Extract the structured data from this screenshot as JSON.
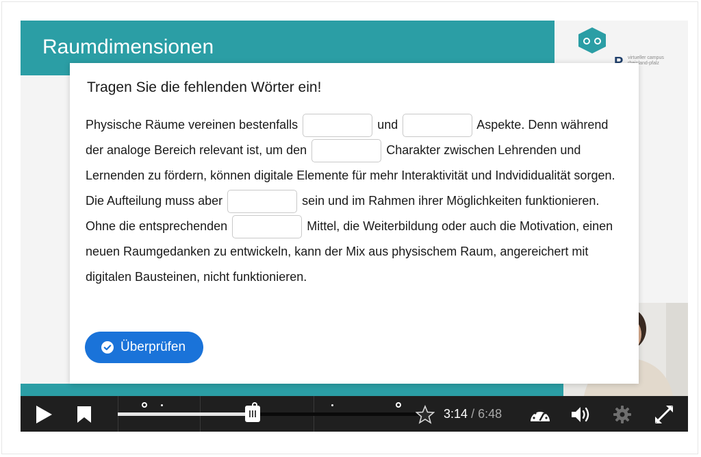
{
  "slide": {
    "title": "Raumdimensionen"
  },
  "logo": {
    "letter": "P",
    "text": "virtueller campus rheinland-pfalz"
  },
  "task": {
    "title": "Tragen Sie die fehlenden Wörter ein!",
    "text_segments": [
      "Physische Räume vereinen bestenfalls",
      "und",
      "Aspekte. Denn während der analoge Bereich relevant ist, um den",
      "Charakter zwischen Lehrenden und Lernenden zu fördern, können digitale Elemente für mehr Interaktivität und Indvididualität sorgen. Die Aufteilung muss aber",
      "sein und im Rahmen ihrer Möglichkeiten funktionieren. Ohne die entsprechenden",
      "Mittel, die Weiterbildung oder auch die Motivation, einen neuen Raumgedanken zu entwickeln, kann der Mix aus physischem Raum, angereichert mit digitalen Bausteinen, nicht funktionieren."
    ],
    "blanks": [
      {
        "value": "",
        "placeholder": ""
      },
      {
        "value": "",
        "placeholder": ""
      },
      {
        "value": "",
        "placeholder": ""
      },
      {
        "value": "",
        "placeholder": ""
      },
      {
        "value": "",
        "placeholder": ""
      }
    ],
    "check_label": "Überprüfen"
  },
  "player": {
    "current_time": "3:14",
    "separator": "/",
    "total_time": "6:48",
    "progress": 0.44,
    "icons": {
      "play": "play-icon",
      "bookmark": "bookmark-icon",
      "end_star": "star-icon",
      "speed": "speedometer-icon",
      "volume": "volume-icon",
      "settings": "gear-icon",
      "fullscreen": "fullscreen-icon"
    }
  },
  "colors": {
    "slide_teal": "#2b9ea5",
    "check_blue": "#1a73d9",
    "control_bar": "#1f1f1f"
  }
}
